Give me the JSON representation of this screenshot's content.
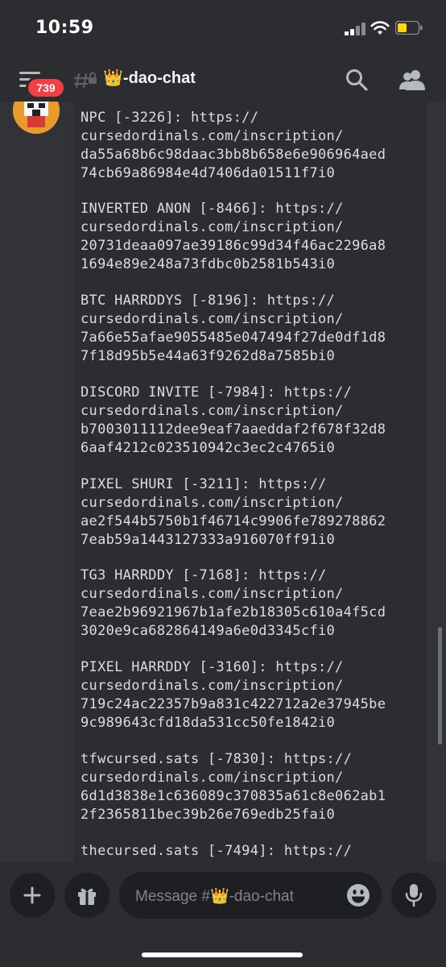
{
  "status_bar": {
    "time": "10:59"
  },
  "header": {
    "notification_count": "739",
    "channel_name": "👑-dao-chat",
    "icons": [
      "hamburger-menu-icon",
      "locked-channel-icon",
      "search-icon",
      "members-icon"
    ]
  },
  "messages": {
    "code_lines": [
      "NPC [-3226]: https://",
      "cursedordinals.com/inscription/",
      "da55a68b6c98daac3bb8b658e6e906964aed",
      "74cb69a86984e4d7406da01511f7i0",
      "",
      "INVERTED ANON [-8466]: https://",
      "cursedordinals.com/inscription/",
      "20731deaa097ae39186c99d34f46ac2296a8",
      "1694e89e248a73fdbc0b2581b543i0",
      "",
      "BTC HARRDDYS [-8196]: https://",
      "cursedordinals.com/inscription/",
      "7a66e55afae9055485e047494f27de0df1d8",
      "7f18d95b5e44a63f9262d8a7585bi0",
      "",
      "DISCORD INVITE [-7984]: https://",
      "cursedordinals.com/inscription/",
      "b7003011112dee9eaf7aaeddaf2f678f32d8",
      "6aaf4212c023510942c3ec2c4765i0",
      "",
      "PIXEL SHURI [-3211]: https://",
      "cursedordinals.com/inscription/",
      "ae2f544b5750b1f46714c9906fe789278862",
      "7eab59a1443127333a916070ff91i0",
      "",
      "TG3 HARRDDY [-7168]: https://",
      "cursedordinals.com/inscription/",
      "7eae2b96921967b1afe2b18305c610a4f5cd",
      "3020e9ca682864149a6e0d3345cfi0",
      "",
      "PIXEL HARRDDY [-3160]: https://",
      "cursedordinals.com/inscription/",
      "719c24ac22357b9a831c422712a2e37945be",
      "9c989643cfd18da531cc50fe1842i0",
      "",
      "tfwcursed.sats [-7830]: https://",
      "cursedordinals.com/inscription/",
      "6d1d3838e1c636089c370835a61c8e062ab1",
      "2f2365811bec39b26e769edb25fai0",
      "",
      "thecursed.sats [-7494]: https://"
    ]
  },
  "composer": {
    "placeholder": "Message #👑-dao-chat",
    "icons": [
      "plus-icon",
      "gift-icon",
      "emoji-icon",
      "microphone-icon"
    ]
  },
  "colors": {
    "background": "#313338",
    "header": "#2b2d31",
    "badge": "#f23f43",
    "input": "#1e1f22"
  }
}
